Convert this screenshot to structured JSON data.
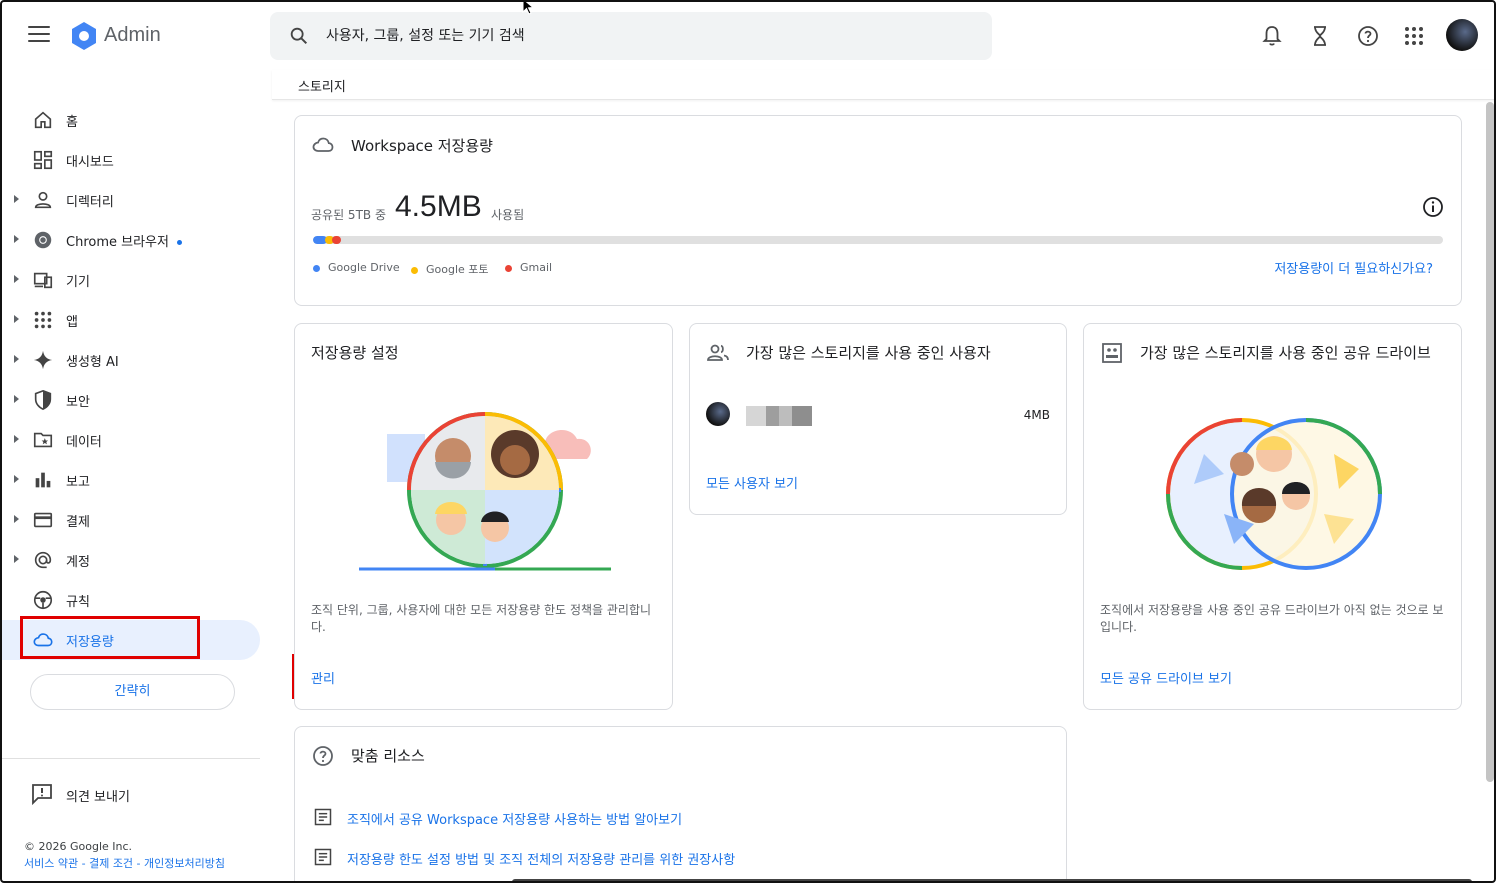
{
  "app": {
    "title": "Admin"
  },
  "search": {
    "placeholder": "사용자, 그룹, 설정 또는 기기 검색"
  },
  "breadcrumb": "스토리지",
  "sidebar": {
    "items": [
      {
        "label": "홈"
      },
      {
        "label": "대시보드"
      },
      {
        "label": "디렉터리"
      },
      {
        "label": "Chrome 브라우저"
      },
      {
        "label": "기기"
      },
      {
        "label": "앱"
      },
      {
        "label": "생성형 AI"
      },
      {
        "label": "보안"
      },
      {
        "label": "데이터"
      },
      {
        "label": "보고"
      },
      {
        "label": "결제"
      },
      {
        "label": "계정"
      },
      {
        "label": "규칙"
      },
      {
        "label": "저장용량"
      }
    ],
    "collapse_label": "간략히",
    "feedback_label": "의견 보내기",
    "copyright": "© 2026 Google Inc.",
    "legal": {
      "terms": "서비스 약관",
      "billing": "결제 조건",
      "privacy": "개인정보처리방침",
      "sep": " - "
    }
  },
  "storage_card": {
    "title": "Workspace 저장용량",
    "usage_prefix": "공유된 5TB 중",
    "usage_amount": "4.5MB",
    "usage_suffix": "사용됨",
    "legend": [
      {
        "label": "Google Drive",
        "color": "#4285f4",
        "fraction": 0.012
      },
      {
        "label": "Google 포토",
        "color": "#fbbc04",
        "fraction": 0.008
      },
      {
        "label": "Gmail",
        "color": "#ea4335",
        "fraction": 0.008
      }
    ],
    "more_link": "저장용량이 더 필요하신가요?"
  },
  "settings_card": {
    "title": "저장용량 설정",
    "description": "조직 단위, 그룹, 사용자에 대한 모든 저장용량 한도 정책을 관리합니다.",
    "manage_link": "관리"
  },
  "users_card": {
    "title": "가장 많은 스토리지를 사용 중인 사용자",
    "user_size": "4MB",
    "all_link": "모든 사용자 보기"
  },
  "drives_card": {
    "title": "가장 많은 스토리지를 사용 중인 공유 드라이브",
    "description": "조직에서 저장용량을 사용 중인 공유 드라이브가 아직 없는 것으로 보입니다.",
    "all_link": "모든 공유 드라이브 보기"
  },
  "resources_card": {
    "title": "맞춤 리소스",
    "items": [
      {
        "label": "조직에서 공유 Workspace 저장용량 사용하는 방법 알아보기"
      },
      {
        "label": "저장용량 한도 설정 방법 및 조직 전체의 저장용량 관리를 위한 권장사항"
      }
    ]
  }
}
